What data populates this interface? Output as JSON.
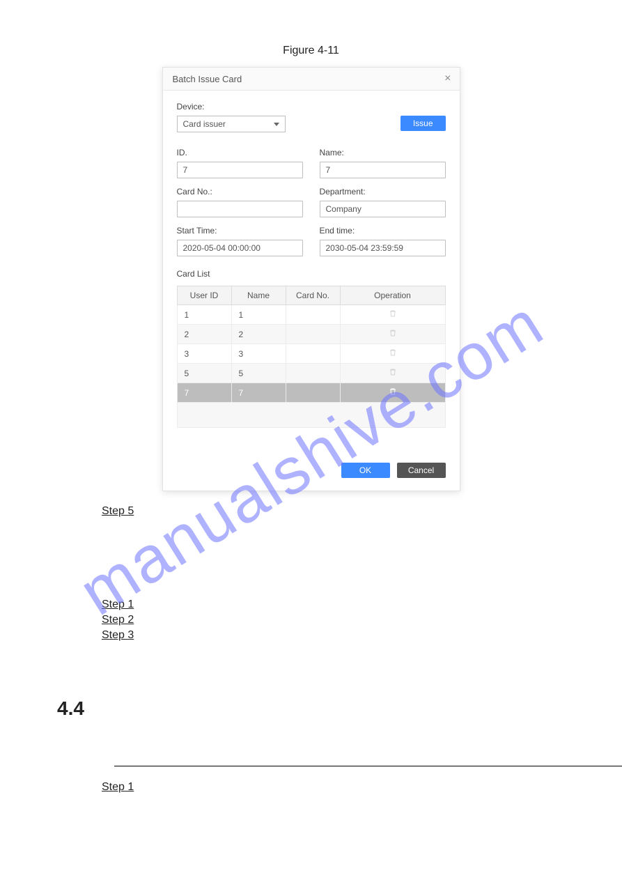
{
  "figure_caption": "Figure 4-11",
  "watermark": "manualshive.com",
  "dialog": {
    "title": "Batch Issue Card",
    "device_label": "Device:",
    "device_value": "Card issuer",
    "issue_btn": "Issue",
    "id_label": "ID.",
    "id_value": "7",
    "name_label": "Name:",
    "name_value": "7",
    "cardno_label": "Card No.:",
    "cardno_value": "",
    "dept_label": "Department:",
    "dept_value": "Company",
    "start_label": "Start Time:",
    "start_value": "2020-05-04 00:00:00",
    "end_label": "End time:",
    "end_value": "2030-05-04 23:59:59",
    "cardlist_label": "Card List",
    "th_userid": "User ID",
    "th_name": "Name",
    "th_cardno": "Card No.",
    "th_op": "Operation",
    "rows": [
      {
        "uid": "1",
        "name": "1",
        "card": ""
      },
      {
        "uid": "2",
        "name": "2",
        "card": ""
      },
      {
        "uid": "3",
        "name": "3",
        "card": ""
      },
      {
        "uid": "5",
        "name": "5",
        "card": ""
      },
      {
        "uid": "7",
        "name": "7",
        "card": ""
      }
    ],
    "ok": "OK",
    "cancel": "Cancel"
  },
  "body": {
    "step5": "Step 5",
    "step1": "Step 1",
    "step2": "Step 2",
    "step3": "Step 3",
    "section": "4.4",
    "step1b": "Step 1"
  }
}
